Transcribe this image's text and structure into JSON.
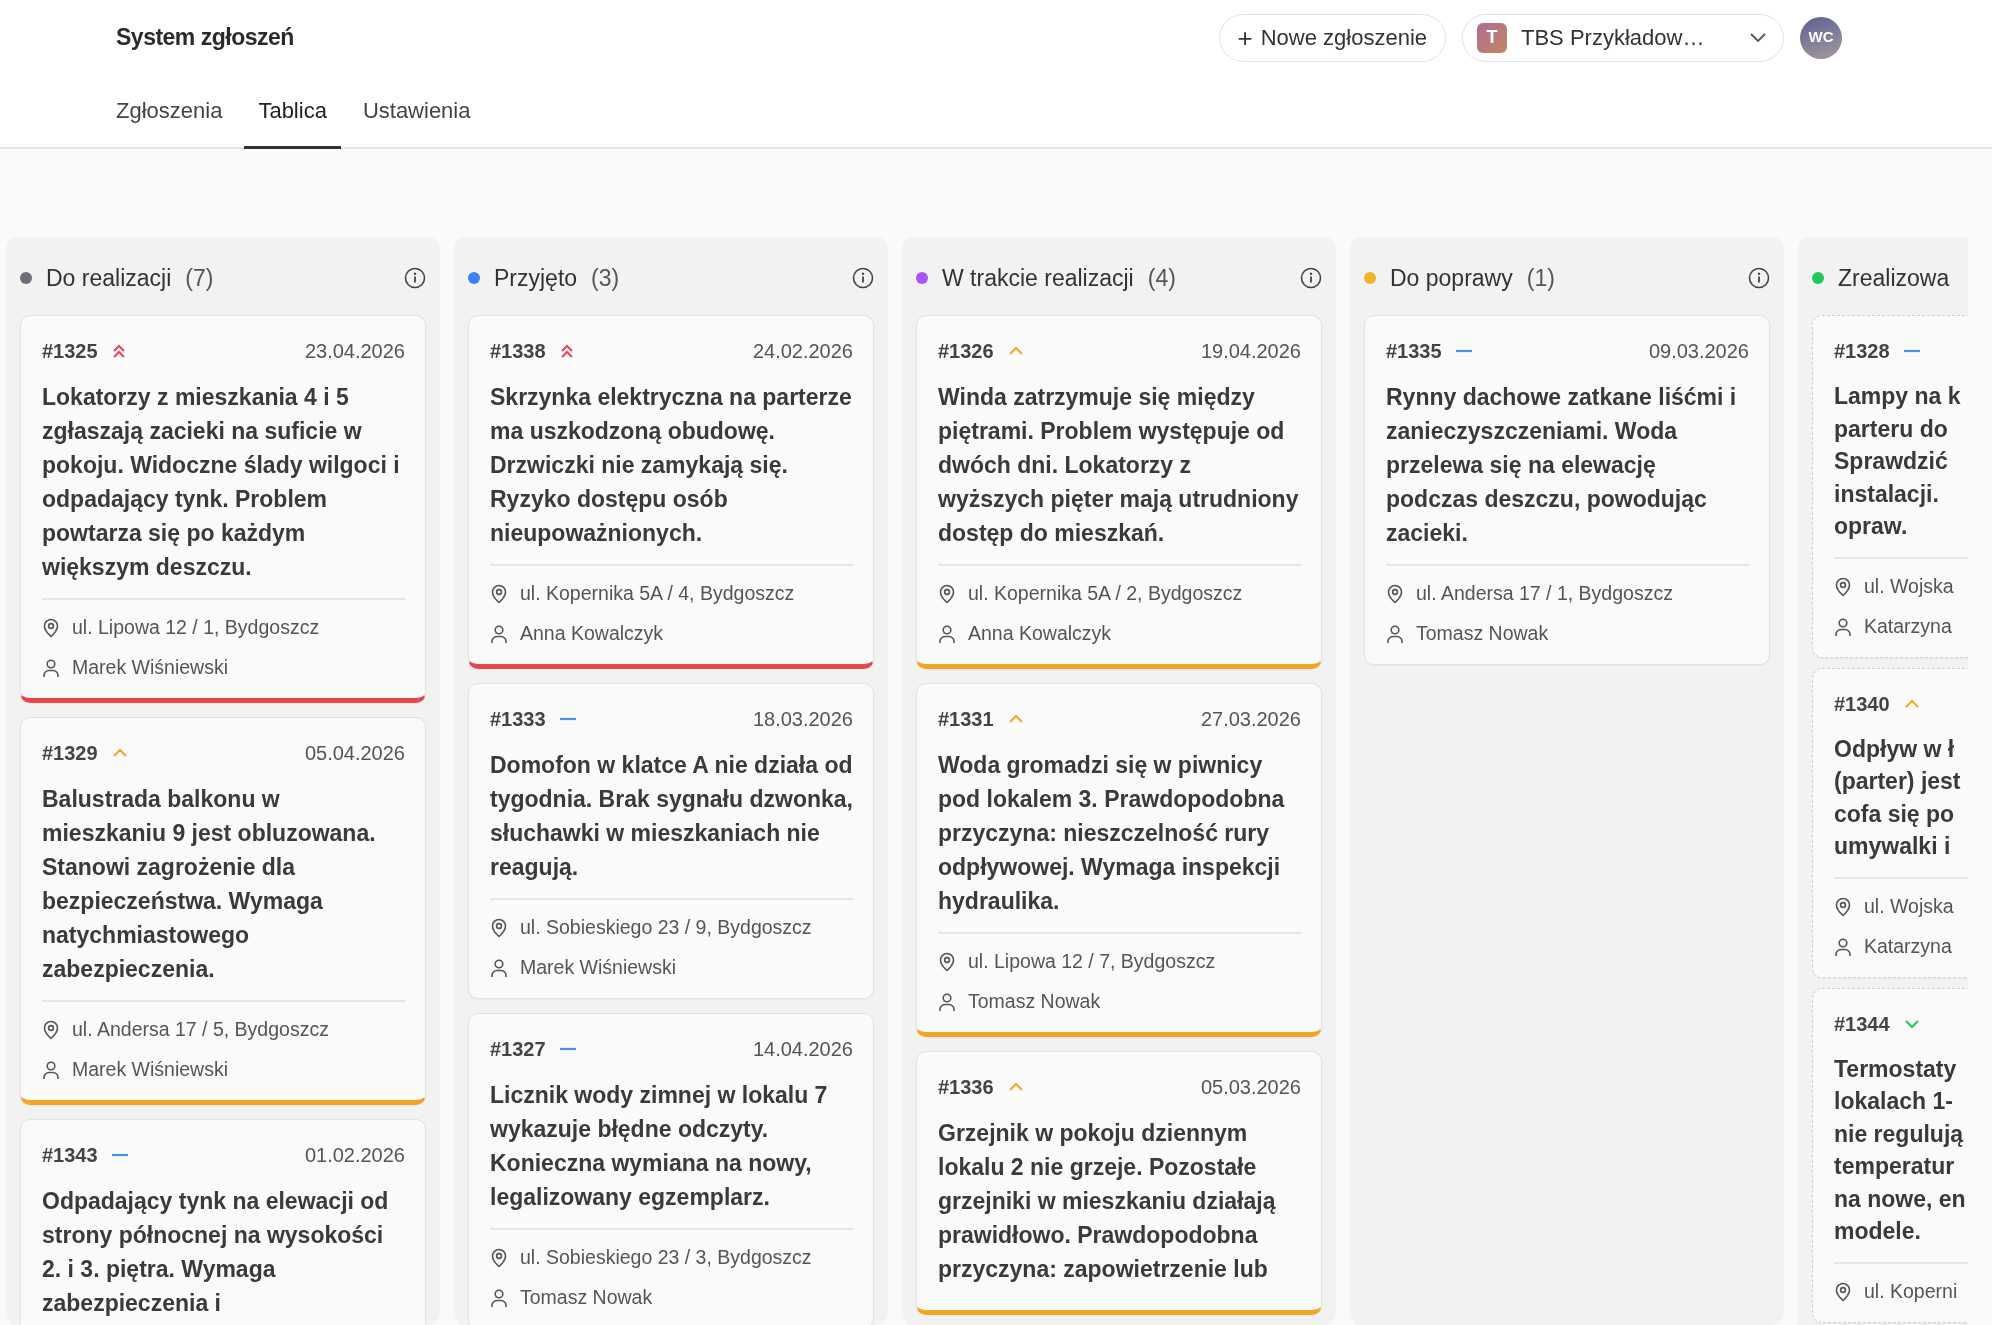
{
  "app_title": "System zgłoszeń",
  "new_button": {
    "icon": "+",
    "label": "Nowe zgłoszenie"
  },
  "workspace": {
    "badge": "T",
    "name": "TBS Przykładow…"
  },
  "avatar": "WC",
  "tabs": [
    {
      "label": "Zgłoszenia",
      "selected": false
    },
    {
      "label": "Tablica",
      "selected": true
    },
    {
      "label": "Ustawienia",
      "selected": false
    }
  ],
  "columns": [
    {
      "title": "Do realizacji",
      "count": "(7)",
      "color": "#6b6e7a",
      "completed": false,
      "cards": [
        {
          "id": "#1325",
          "kind": "highest",
          "date": "23.04.2026",
          "description": "Lokatorzy z mieszkania 4 i 5 zgłaszają zacieki na suficie w pokoju. Widoczne ślady wilgoci i odpadający tynk. Problem powtarza się po każdym większym deszczu.",
          "address": "ul. Lipowa 12 / 1, Bydgoszcz",
          "person": "Marek Wiśniewski"
        },
        {
          "id": "#1329",
          "kind": "high",
          "date": "05.04.2026",
          "description": "Balustrada balkonu w mieszkaniu 9 jest obluzowana. Stanowi zagrożenie dla bezpieczeństwa. Wymaga natychmiastowego zabezpieczenia.",
          "address": "ul. Andersa 17 / 5, Bydgoszcz",
          "person": "Marek Wiśniewski"
        },
        {
          "id": "#1343",
          "kind": "low",
          "date": "01.02.2026",
          "description": "Odpadający tynk na elewacji od strony północnej na wysokości 2. i 3. piętra. Wymaga zabezpieczenia i"
        }
      ]
    },
    {
      "title": "Przyjęto",
      "count": "(3)",
      "color": "#3b82f6",
      "completed": false,
      "cards": [
        {
          "id": "#1338",
          "kind": "highest",
          "date": "24.02.2026",
          "description": "Skrzynka elektryczna na parterze ma uszkodzoną obudowę. Drzwiczki nie zamykają się. Ryzyko dostępu osób nieupoważnionych.",
          "address": "ul. Kopernika 5A / 4, Bydgoszcz",
          "person": "Anna Kowalczyk"
        },
        {
          "id": "#1333",
          "kind": "low",
          "date": "18.03.2026",
          "description": "Domofon w klatce A nie działa od tygodnia. Brak sygnału dzwonka, słuchawki w mieszkaniach nie reagują.",
          "address": "ul. Sobieskiego 23 / 9, Bydgoszcz",
          "person": "Marek Wiśniewski"
        },
        {
          "id": "#1327",
          "kind": "low",
          "date": "14.04.2026",
          "description": "Licznik wody zimnej w lokalu 7 wykazuje błędne odczyty. Konieczna wymiana na nowy, legalizowany egzemplarz.",
          "address": "ul. Sobieskiego 23 / 3, Bydgoszcz",
          "person": "Tomasz Nowak"
        }
      ]
    },
    {
      "title": "W trakcie realizacji",
      "count": "(4)",
      "color": "#a855f7",
      "completed": false,
      "cards": [
        {
          "id": "#1326",
          "kind": "high",
          "date": "19.04.2026",
          "description": "Winda zatrzymuje się między piętrami. Problem występuje od dwóch dni. Lokatorzy z wyższych pięter mają utrudniony dostęp do mieszkań.",
          "address": "ul. Kopernika 5A / 2, Bydgoszcz",
          "person": "Anna Kowalczyk"
        },
        {
          "id": "#1331",
          "kind": "high",
          "date": "27.03.2026",
          "description": "Woda gromadzi się w piwnicy pod lokalem 3. Prawdopodobna przyczyna: nieszczelność rury odpływowej. Wymaga inspekcji hydraulika.",
          "address": "ul. Lipowa 12 / 7, Bydgoszcz",
          "person": "Tomasz Nowak"
        },
        {
          "id": "#1336",
          "kind": "high",
          "date": "05.03.2026",
          "description": "Grzejnik w pokoju dziennym lokalu 2 nie grzeje. Pozostałe grzejniki w mieszkaniu działają prawidłowo. Prawdopodobna przyczyna: zapowietrzenie lub"
        }
      ]
    },
    {
      "title": "Do poprawy",
      "count": "(1)",
      "color": "#f0b429",
      "completed": false,
      "cards": [
        {
          "id": "#1335",
          "kind": "low",
          "date": "09.03.2026",
          "description": "Rynny dachowe zatkane liśćmi i zanieczyszczeniami. Woda przelewa się na elewację podczas deszczu, powodując zacieki.",
          "address": "ul. Andersa 17 / 1, Bydgoszcz",
          "person": "Tomasz Nowak"
        }
      ]
    },
    {
      "title": "Zrealizowa",
      "color": "#22c55e",
      "completed": true,
      "cards": [
        {
          "id": "#1328",
          "kind": "low",
          "description": "Lampy na k\nparteru do\nSprawdzić\ninstalacji.\nopraw.",
          "address": "ul. Wojska",
          "person": "Katarzyna"
        },
        {
          "id": "#1340",
          "kind": "high",
          "description": "Odpływ w ł\n(parter) jest\ncofa się po\numywalki i",
          "address": "ul. Wojska",
          "person": "Katarzyna"
        },
        {
          "id": "#1344",
          "kind": "lowest",
          "description": "Termostaty\nlokalach 1-\nnie regulują\ntemperatur\nna nowe, en\nmodele.",
          "address": "ul. Koperni"
        }
      ]
    }
  ]
}
